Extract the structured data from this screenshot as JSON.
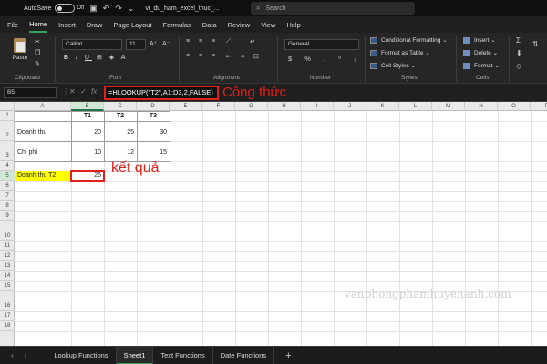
{
  "titlebar": {
    "autosave_label": "AutoSave",
    "autosave_state": "Off",
    "filename": "vi_du_ham_excel_thuc_...",
    "search_placeholder": "Search"
  },
  "menu": [
    "File",
    "Home",
    "Insert",
    "Draw",
    "Page Layout",
    "Formulas",
    "Data",
    "Review",
    "View",
    "Help"
  ],
  "ribbon": {
    "clipboard": {
      "paste": "Paste",
      "label": "Clipboard"
    },
    "font": {
      "name": "Calibri",
      "size": "11",
      "label": "Font"
    },
    "alignment": {
      "label": "Alignment"
    },
    "number": {
      "format": "General",
      "label": "Number"
    },
    "styles": {
      "conditional": "Conditional Formatting",
      "format_table": "Format as Table",
      "cell_styles": "Cell Styles",
      "label": "Styles"
    },
    "cells": {
      "insert": "Insert",
      "delete": "Delete",
      "format": "Format",
      "label": "Cells"
    }
  },
  "formula_bar": {
    "name_box": "B5",
    "formula": "=HLOOKUP(\"T2\",A1:D3,2,FALSE)",
    "annotation": "Công thức"
  },
  "grid": {
    "columns": [
      "A",
      "B",
      "C",
      "D",
      "E",
      "F",
      "G",
      "H",
      "I",
      "J",
      "K",
      "L",
      "M",
      "N",
      "O",
      "P"
    ],
    "rows": [
      "1",
      "2",
      "3",
      "4",
      "5",
      "6",
      "7",
      "8",
      "9",
      "10",
      "11",
      "12",
      "13",
      "14",
      "15",
      "16",
      "17",
      "18"
    ],
    "headers": [
      "T1",
      "T2",
      "T3"
    ],
    "row2_label": "Doanh thu",
    "row2_values": [
      "20",
      "25",
      "30"
    ],
    "row3_label": "Chi phí",
    "row3_values": [
      "10",
      "12",
      "15"
    ],
    "a5_label": "Doanh thu T2",
    "b5_value": "25",
    "result_annotation": "kết quả",
    "watermark": "vanphongphamhuyenanh.com"
  },
  "sheets": [
    "Lookup Functions",
    "Sheet1",
    "Text Functions",
    "Date Functions"
  ],
  "colors": {
    "annotation_red": "#e0201b",
    "highlight_yellow": "#ffff00",
    "excel_green": "#217346"
  }
}
